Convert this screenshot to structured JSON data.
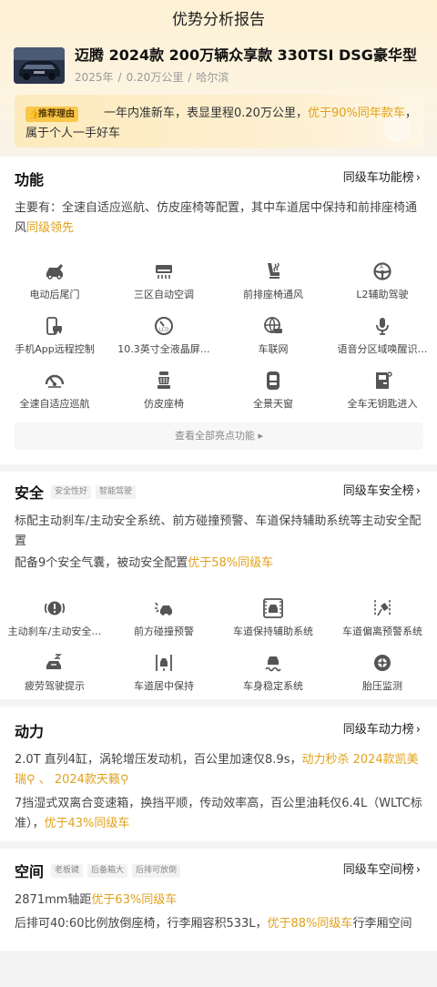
{
  "nav": {
    "title": "优势分析报告"
  },
  "car": {
    "title": "迈腾 2024款 200万辆众享款 330TSI DSG豪华型",
    "year": "2025年",
    "mileage": "0.20万公里",
    "city": "哈尔滨",
    "sep": "/"
  },
  "reason": {
    "badge": "推荐理由",
    "text_a": "一年内准新车，表显里程0.20万公里，",
    "text_hl": "优于90%同年款车",
    "text_b": "，属于个人一手好车"
  },
  "function": {
    "title": "功能",
    "link": "同级车功能榜",
    "desc_a": "主要有：全速自适应巡航、仿皮座椅等配置，其中车道居中保持和前排座椅通风",
    "desc_hl": "同级领先",
    "features": [
      {
        "label": "电动后尾门",
        "icon": "tailgate-icon"
      },
      {
        "label": "三区自动空调",
        "icon": "ac-icon"
      },
      {
        "label": "前排座椅通风",
        "icon": "seat-vent-icon"
      },
      {
        "label": "L2辅助驾驶",
        "icon": "steering-icon"
      },
      {
        "label": "手机App远程控制",
        "icon": "phone-car-icon"
      },
      {
        "label": "10.3英寸全液晶屏…",
        "icon": "lcd-gauge-icon"
      },
      {
        "label": "车联网",
        "icon": "globe-car-icon"
      },
      {
        "label": "语音分区域唤醒识…",
        "icon": "mic-icon"
      },
      {
        "label": "全速自适应巡航",
        "icon": "speedometer-icon"
      },
      {
        "label": "仿皮座椅",
        "icon": "seat-icon"
      },
      {
        "label": "全景天窗",
        "icon": "sunroof-icon"
      },
      {
        "label": "全车无钥匙进入",
        "icon": "keyless-door-icon"
      }
    ],
    "view_all": "查看全部亮点功能"
  },
  "safety": {
    "title": "安全",
    "tags": [
      "安全性好",
      "智能驾驶"
    ],
    "link": "同级车安全榜",
    "desc1": "标配主动刹车/主动安全系统、前方碰撞预警、车道保持辅助系统等主动安全配置",
    "desc2_a": "配备9个安全气囊，被动安全配置",
    "desc2_hl": "优于58%同级车",
    "features": [
      {
        "label": "主动刹车/主动安全…",
        "icon": "brake-warning-icon"
      },
      {
        "label": "前方碰撞预警",
        "icon": "collision-icon"
      },
      {
        "label": "车道保持辅助系统",
        "icon": "lane-keep-icon"
      },
      {
        "label": "车道偏离预警系统",
        "icon": "lane-depart-icon"
      },
      {
        "label": "疲劳驾驶提示",
        "icon": "fatigue-icon"
      },
      {
        "label": "车道居中保持",
        "icon": "lane-center-icon"
      },
      {
        "label": "车身稳定系统",
        "icon": "stability-icon"
      },
      {
        "label": "胎压监测",
        "icon": "tire-icon"
      }
    ]
  },
  "power": {
    "title": "动力",
    "link": "同级车动力榜",
    "desc1_a": "2.0T 直列4缸，涡轮增压发动机，百公里加速仅8.9s，",
    "desc1_hl1": "动力秒杀 2024款凯美瑞",
    "desc1_mid": " 、 ",
    "desc1_hl2": "2024款天籁",
    "desc2_a": "7挡湿式双离合变速箱，换挡平顺，传动效率高，百公里油耗仅6.4L（WLTC标准），",
    "desc2_hl": "优于43%同级车"
  },
  "space": {
    "title": "空间",
    "tags": [
      "老板键",
      "后备箱大",
      "后排可放倒"
    ],
    "link": "同级车空间榜",
    "desc1_a": "2871mm轴距",
    "desc1_hl": "优于63%同级车",
    "desc2_a": "后排可40:60比例放倒座椅，行李厢容积533L，",
    "desc2_hl": "优于88%同级车",
    "desc2_b": "行李厢空间"
  },
  "colors": {
    "accent": "#e0a21b",
    "badge": "#f9c84b"
  }
}
